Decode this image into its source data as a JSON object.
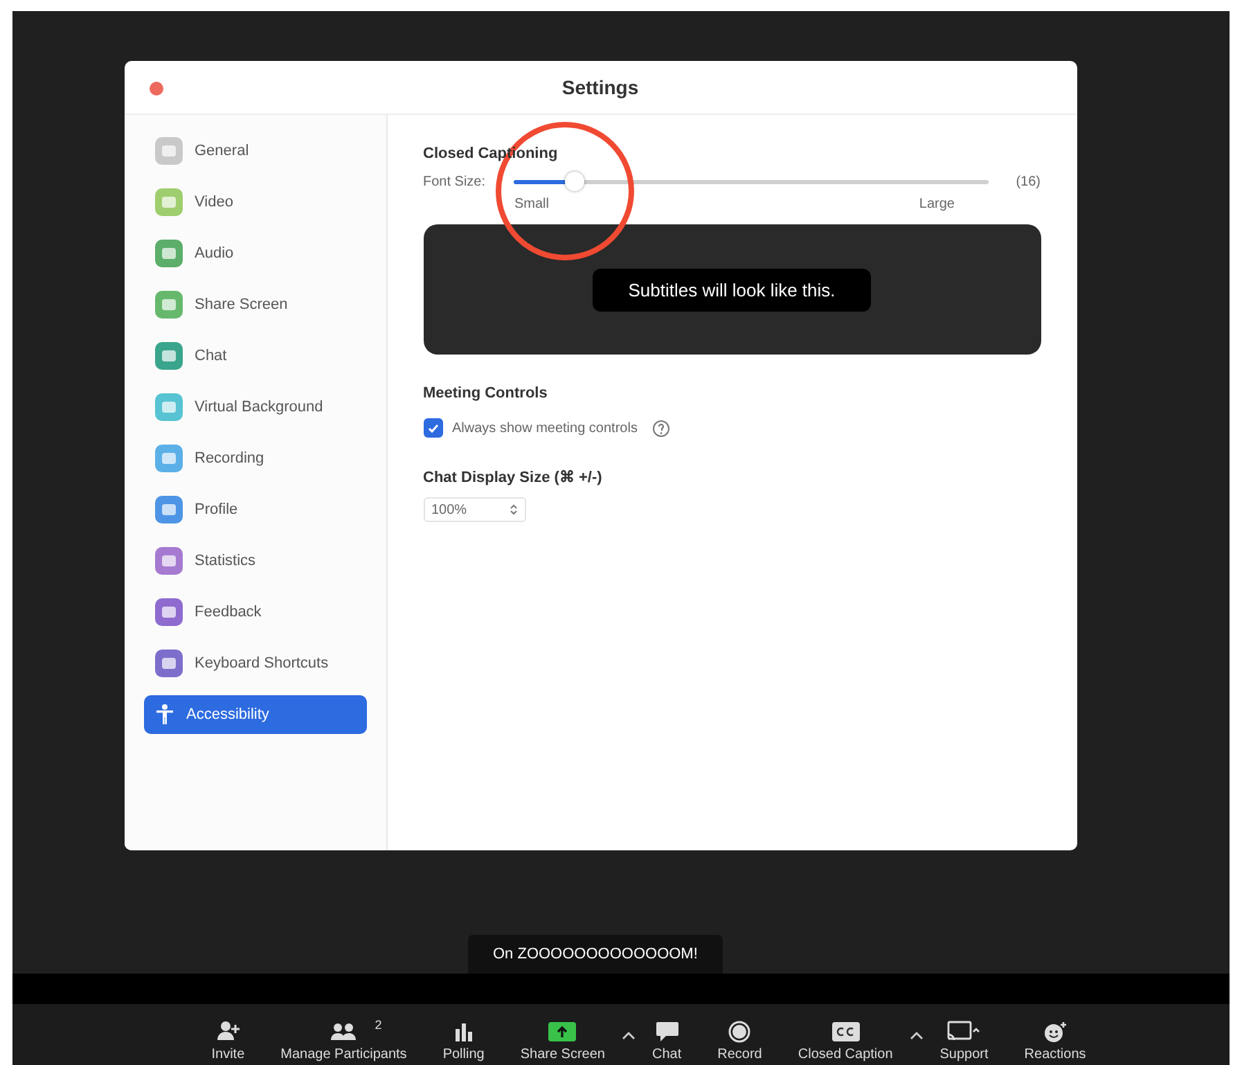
{
  "window": {
    "title": "Settings"
  },
  "sidebar": {
    "items": [
      {
        "label": "General",
        "color": "#c9c9c9",
        "selected": false
      },
      {
        "label": "Video",
        "color": "#9fce6e",
        "selected": false
      },
      {
        "label": "Audio",
        "color": "#5cae6a",
        "selected": false
      },
      {
        "label": "Share Screen",
        "color": "#66b86d",
        "selected": false
      },
      {
        "label": "Chat",
        "color": "#3aa58d",
        "selected": false
      },
      {
        "label": "Virtual Background",
        "color": "#57c3d3",
        "selected": false
      },
      {
        "label": "Recording",
        "color": "#5cb0e8",
        "selected": false
      },
      {
        "label": "Profile",
        "color": "#4e95e6",
        "selected": false
      },
      {
        "label": "Statistics",
        "color": "#a57ad0",
        "selected": false
      },
      {
        "label": "Feedback",
        "color": "#8f6bd0",
        "selected": false
      },
      {
        "label": "Keyboard Shortcuts",
        "color": "#7d6ecc",
        "selected": false
      },
      {
        "label": "Accessibility",
        "color": "#ffffff",
        "selected": true
      }
    ]
  },
  "closed_captioning": {
    "heading": "Closed Captioning",
    "font_size_label": "Font Size:",
    "level": 0.13,
    "reading": "(16)",
    "min_label": "Small",
    "max_label": "Large",
    "preview": "Subtitles will look like this."
  },
  "meeting_controls": {
    "heading": "Meeting Controls",
    "checkbox": {
      "label": "Always show meeting controls",
      "checked": true
    }
  },
  "chat_display_size": {
    "heading": "Chat Display Size (⌘ +/-)",
    "value": "100%"
  },
  "notification": "On ZOOOOOOOOOOOOOM!",
  "toolbar": [
    {
      "kind": "button",
      "label": "Invite"
    },
    {
      "kind": "button",
      "label": "Manage Participants",
      "count": "2"
    },
    {
      "kind": "button",
      "label": "Polling"
    },
    {
      "kind": "button",
      "label": "Share Screen"
    },
    {
      "kind": "caret"
    },
    {
      "kind": "button",
      "label": "Chat"
    },
    {
      "kind": "button",
      "label": "Record"
    },
    {
      "kind": "button",
      "label": "Closed Caption"
    },
    {
      "kind": "caret"
    },
    {
      "kind": "button",
      "label": "Support"
    },
    {
      "kind": "button",
      "label": "Reactions"
    }
  ]
}
